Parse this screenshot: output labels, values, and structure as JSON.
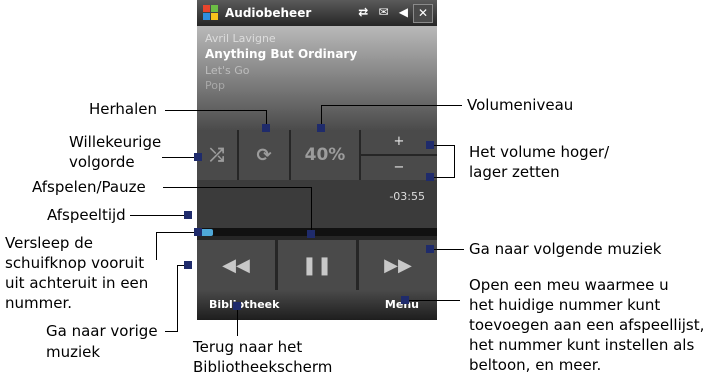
{
  "window": {
    "title": "Audiobeheer",
    "close_label": "✕",
    "status_icons": "⇄ ✉ ◀"
  },
  "track": {
    "artist": "Avril Lavigne",
    "song": "Anything But Ordinary",
    "album": "Let's Go",
    "genre": "Pop"
  },
  "controls": {
    "volume_level": "40%",
    "vol_up": "+",
    "vol_down": "−",
    "remaining_time": "-03:55"
  },
  "menubar": {
    "left": "Bibliotheek",
    "right": "Menu"
  },
  "annotations": {
    "repeat": "Herhalen",
    "shuffle_1": "Willekeurige",
    "shuffle_2": "volgorde",
    "play_pause": "Afspelen/Pauze",
    "play_time": "Afspeeltijd",
    "drag_1": "Versleep de",
    "drag_2": "schuifknop vooruit",
    "drag_3": "uit achteruit in een",
    "drag_4": "nummer.",
    "prev_1": "Ga naar vorige",
    "prev_2": "muziek",
    "back_1": "Terug naar het",
    "back_2": "Bibliotheekscherm",
    "volume_level": "Volumeniveau",
    "vol_1": "Het volume hoger/",
    "vol_2": "lager zetten",
    "next": "Ga naar volgende muziek",
    "menu_1": "Open een meu waarmee u",
    "menu_2": "het huidige nummer kunt",
    "menu_3": "toevoegen aan een afspeellijst,",
    "menu_4": "het nummer kunt instellen als",
    "menu_5": "beltoon, en meer."
  }
}
